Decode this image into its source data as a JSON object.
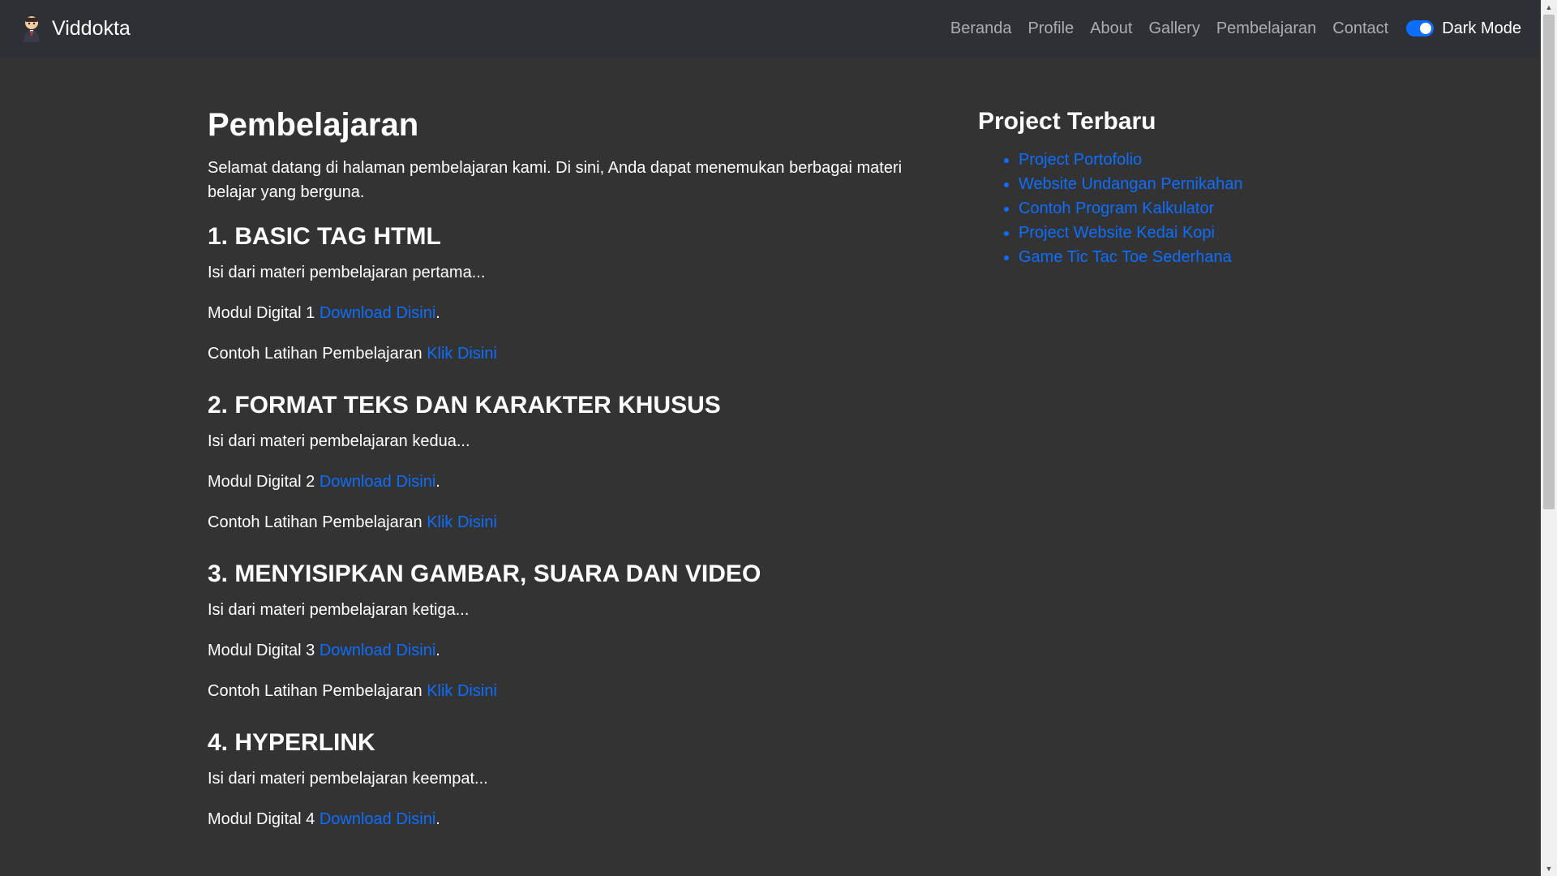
{
  "navbar": {
    "brand": "Viddokta",
    "links": [
      "Beranda",
      "Profile",
      "About",
      "Gallery",
      "Pembelajaran",
      "Contact"
    ],
    "toggle_label": "Dark Mode",
    "toggle_on": true
  },
  "main": {
    "title": "Pembelajaran",
    "intro": "Selamat datang di halaman pembelajaran kami. Di sini, Anda dapat menemukan berbagai materi belajar yang berguna.",
    "sections": [
      {
        "heading": "1. BASIC TAG HTML",
        "desc": "Isi dari materi pembelajaran pertama...",
        "module_text": "Modul Digital 1",
        "download_link": "Download Disini",
        "exercise_text": "Contoh Latihan Pembelajaran",
        "exercise_link": "Klik Disini"
      },
      {
        "heading": "2. FORMAT TEKS DAN KARAKTER KHUSUS",
        "desc": "Isi dari materi pembelajaran kedua...",
        "module_text": "Modul Digital 2",
        "download_link": "Download Disini",
        "exercise_text": "Contoh Latihan Pembelajaran",
        "exercise_link": "Klik Disini"
      },
      {
        "heading": "3. MENYISIPKAN GAMBAR, SUARA DAN VIDEO",
        "desc": "Isi dari materi pembelajaran ketiga...",
        "module_text": "Modul Digital 3",
        "download_link": "Download Disini",
        "exercise_text": "Contoh Latihan Pembelajaran",
        "exercise_link": "Klik Disini"
      },
      {
        "heading": "4. HYPERLINK",
        "desc": "Isi dari materi pembelajaran keempat...",
        "module_text": "Modul Digital 4",
        "download_link": "Download Disini"
      }
    ]
  },
  "sidebar": {
    "title": "Project Terbaru",
    "projects": [
      "Project Portofolio",
      "Website Undangan Pernikahan",
      "Contoh Program Kalkulator",
      "Project Website Kedai Kopi",
      "Game Tic Tac Toe Sederhana"
    ]
  },
  "colors": {
    "background": "#333333",
    "navbar": "#2d3035",
    "link": "#0d6efd",
    "nav_link": "#9a9b9d"
  }
}
